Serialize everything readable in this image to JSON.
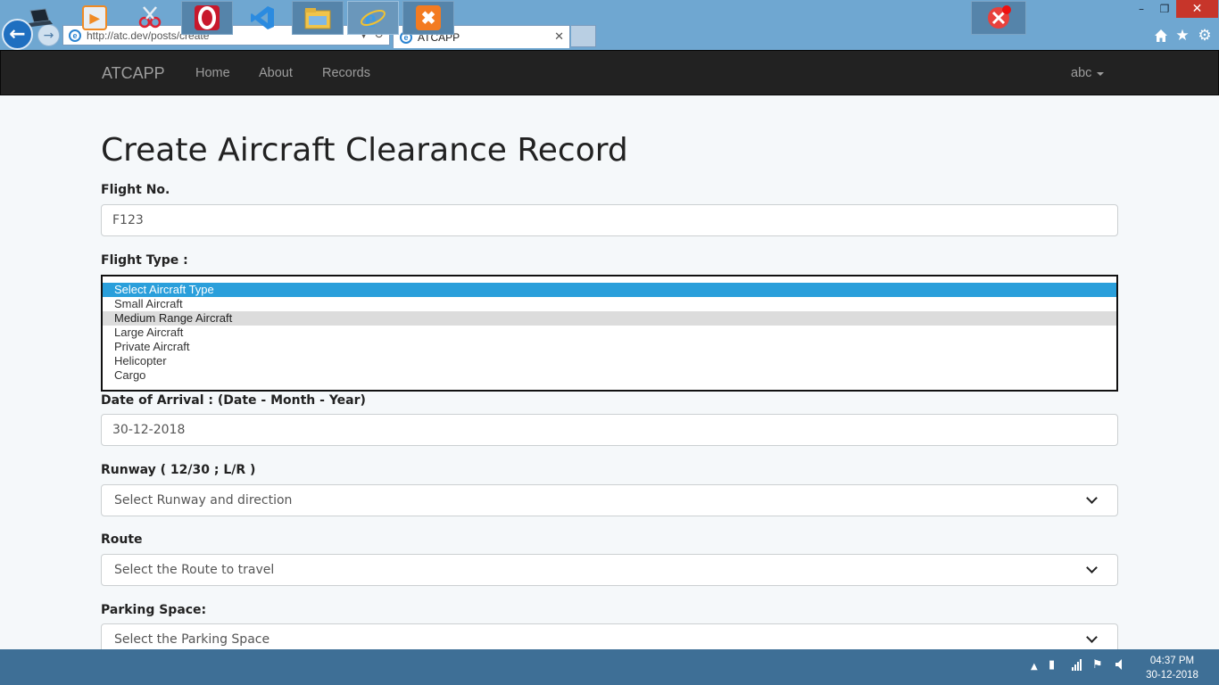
{
  "browser": {
    "url": "http://atc.dev/posts/create",
    "tab_title": "ATCAPP",
    "window_controls": {
      "minimize": "–",
      "restore": "❐",
      "close": "✕"
    },
    "toolbar_icons": [
      "home-icon",
      "star-icon",
      "gear-icon"
    ]
  },
  "navbar": {
    "brand": "ATCAPP",
    "links": [
      "Home",
      "About",
      "Records"
    ],
    "user": "abc"
  },
  "page": {
    "title": "Create Aircraft Clearance Record"
  },
  "form": {
    "flight_no": {
      "label": "Flight No.",
      "value": "F123"
    },
    "flight_type": {
      "label": "Flight Type :",
      "options": [
        "Select Aircraft Type",
        "Small Aircraft",
        "Medium Range Aircraft",
        "Large Aircraft",
        "Private Aircraft",
        "Helicopter",
        "Cargo"
      ],
      "selected": "Select Aircraft Type",
      "highlighted": "Medium Range Aircraft"
    },
    "date_of_arrival": {
      "label": "Date of Arrival : (Date - Month - Year)",
      "value": "30-12-2018"
    },
    "runway": {
      "label": "Runway ( 12/30 ; L/R )",
      "value": "Select Runway and direction"
    },
    "route": {
      "label": "Route",
      "value": "Select the Route to travel"
    },
    "parking": {
      "label": "Parking Space:",
      "value": "Select the Parking Space"
    }
  },
  "taskbar": {
    "apps": [
      "laptop-icon",
      "media-player-icon",
      "snipping-tool-icon",
      "opera-icon",
      "vscode-icon",
      "file-explorer-icon",
      "internet-explorer-icon",
      "xampp-icon"
    ],
    "clock": {
      "time": "04:37 PM",
      "date": "30-12-2018"
    }
  },
  "colors": {
    "navbar_bg": "#222222",
    "selected_option": "#2a9fdb",
    "taskbar_bg": "#3e6f96",
    "browser_chrome": "#6fa7d1"
  }
}
